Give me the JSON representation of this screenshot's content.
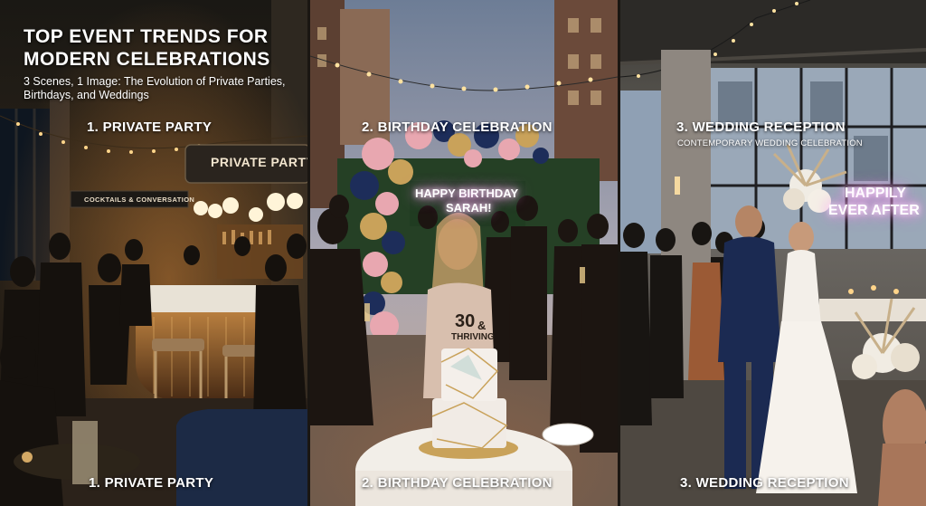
{
  "header": {
    "title": "TOP EVENT TRENDS FOR MODERN CELEBRATIONS",
    "subtitle": "3 Scenes, 1 Image: The Evolution of Private Parties, Birthdays, and Weddings"
  },
  "panels": [
    {
      "label": "1. PRIVATE PARTY",
      "footer_label": "1. PRIVATE PARTY",
      "bar_sign": "PRIVATE PARTY",
      "small_sign": "COCKTAILS & CONVERSATION"
    },
    {
      "label": "2. BIRTHDAY CELEBRATION",
      "footer_label": "2. BIRTHDAY CELEBRATION",
      "neon_line1": "HAPPY BIRTHDAY",
      "neon_line2": "SARAH!",
      "cake_topper_line1": "30",
      "cake_topper_amp": "&",
      "cake_topper_line2": "THRIVING"
    },
    {
      "label": "3. WEDDING RECEPTION",
      "sublabel": "CONTEMPORARY WEDDING CELEBRATION",
      "footer_label": "3. WEDDING RECEPTION",
      "neon_line1": "HAPPILY",
      "neon_line2": "EVER AFTER"
    }
  ],
  "colors": {
    "party_warm": "#d89a52",
    "birthday_pink": "#e8a7b0",
    "birthday_navy": "#1d2d5a",
    "birthday_gold": "#c9a25a",
    "wedding_sky": "#c8ccd0",
    "neon_pink": "#ff9ef2"
  }
}
